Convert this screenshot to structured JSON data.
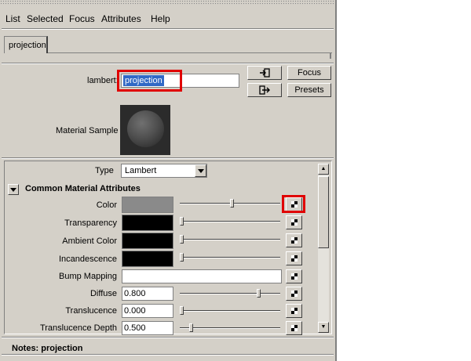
{
  "menubar": [
    "List",
    "Selected",
    "Focus",
    "Attributes",
    "Help"
  ],
  "tab": {
    "label": "projection"
  },
  "node": {
    "label": "lambert:",
    "name": "projection"
  },
  "buttons": {
    "focus": "Focus",
    "presets": "Presets"
  },
  "material_sample": {
    "label": "Material Sample"
  },
  "type": {
    "label": "Type",
    "value": "Lambert"
  },
  "section": {
    "title": "Common Material Attributes"
  },
  "attributes": [
    {
      "label": "Color",
      "kind": "swatch",
      "color": "#8a8a8a",
      "slider": 0.52
    },
    {
      "label": "Transparency",
      "kind": "swatch",
      "color": "#000000",
      "slider": 0.0
    },
    {
      "label": "Ambient Color",
      "kind": "swatch",
      "color": "#000000",
      "slider": 0.0
    },
    {
      "label": "Incandescence",
      "kind": "swatch",
      "color": "#000000",
      "slider": 0.0
    },
    {
      "label": "Bump Mapping",
      "kind": "field"
    },
    {
      "label": "Diffuse",
      "kind": "number",
      "value": "0.800",
      "slider": 0.8
    },
    {
      "label": "Translucence",
      "kind": "number",
      "value": "0.000",
      "slider": 0.0
    },
    {
      "label": "Translucence Depth",
      "kind": "number",
      "value": "0.500",
      "slider": 0.1
    }
  ],
  "notes": {
    "title": "Notes:  projection"
  }
}
